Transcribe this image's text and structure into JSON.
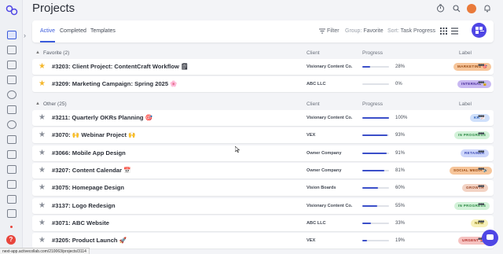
{
  "header": {
    "title": "Projects",
    "icons": [
      "stopwatch-icon",
      "search-icon",
      "avatar",
      "bell-icon"
    ]
  },
  "sidebar": {
    "icons": [
      "apps-icon",
      "profile-icon",
      "briefcase-icon",
      "calendar-icon",
      "people-icon",
      "book-icon",
      "target-icon",
      "layers-icon",
      "clipboard-icon",
      "timesheet-icon",
      "invoice-icon",
      "trash-icon",
      "help-icon"
    ]
  },
  "tabs": {
    "active": "Active",
    "completed": "Completed",
    "templates": "Templates"
  },
  "toolbar": {
    "filter_label": "Filter",
    "group_key": "Group:",
    "group_value": "Favorite",
    "sort_key": "Sort:",
    "sort_value": "Task Progress"
  },
  "columns": {
    "client": "Client",
    "progress": "Progress",
    "label": "Label"
  },
  "groups": [
    {
      "name": "Favorite (2)",
      "rows": [
        {
          "name": "#3203: Client Project: ContentCraft Workflow 🗒",
          "client": "Visionary Content Co.",
          "progress": 28,
          "progress_text": "28%",
          "label": "MARKETING 🎯",
          "label_bg": "#f6c59a",
          "label_fg": "#9a4a12",
          "favorite": true
        },
        {
          "name": "#3209: Marketing Campaign: Spring 2025 🌸",
          "client": "ABC LLC",
          "progress": 0,
          "progress_text": "0%",
          "label": "INTERNAL 🔒",
          "label_bg": "#c8b8f2",
          "label_fg": "#4b2f9c",
          "favorite": true
        }
      ]
    },
    {
      "name": "Other (25)",
      "rows": [
        {
          "name": "#3211: Quarterly OKRs Planning 🎯",
          "client": "Visionary Content Co.",
          "progress": 100,
          "progress_text": "100%",
          "label": "KR 📈",
          "label_bg": "#cfe0fb",
          "label_fg": "#2a5fb8",
          "favorite": false
        },
        {
          "name": "#3070: 🙌 Webinar Project 🙌",
          "client": "VEX",
          "progress": 93,
          "progress_text": "93%",
          "label": "IN PROGRESS",
          "label_bg": "#d3f2d9",
          "label_fg": "#2b8a44",
          "favorite": false
        },
        {
          "name": "#3066: Mobile App Design",
          "client": "Owner Company",
          "progress": 91,
          "progress_text": "91%",
          "label": "RETAINER",
          "label_bg": "#cdd6fb",
          "label_fg": "#3a49b3",
          "favorite": false
        },
        {
          "name": "#3207: Content Calendar 📅",
          "client": "Owner Company",
          "progress": 81,
          "progress_text": "81%",
          "label": "SOCIAL MEDIA 🔊",
          "label_bg": "#f6c59a",
          "label_fg": "#9a4a12",
          "favorite": false
        },
        {
          "name": "#3075: Homepage Design",
          "client": "Vision Boards",
          "progress": 60,
          "progress_text": "60%",
          "label": "GROWTH",
          "label_bg": "#f3d3c4",
          "label_fg": "#9c4a2a",
          "favorite": false
        },
        {
          "name": "#3137: Logo Redesign",
          "client": "Visionary Content Co.",
          "progress": 55,
          "progress_text": "55%",
          "label": "IN PROGRESS",
          "label_bg": "#d3f2d9",
          "label_fg": "#2b8a44",
          "favorite": false
        },
        {
          "name": "#3071: ABC Website",
          "client": "ABC LLC",
          "progress": 33,
          "progress_text": "33%",
          "label": "NEW",
          "label_bg": "#f7f0b8",
          "label_fg": "#8a7a12",
          "favorite": false
        },
        {
          "name": "#3205: Product Launch 🚀",
          "client": "VEX",
          "progress": 19,
          "progress_text": "19%",
          "label": "URGENT 🚨",
          "label_bg": "#f6c2c0",
          "label_fg": "#b0302a",
          "favorite": false
        }
      ]
    }
  ],
  "status_url": "next-app.activecollab.com/210063/projects/3114"
}
